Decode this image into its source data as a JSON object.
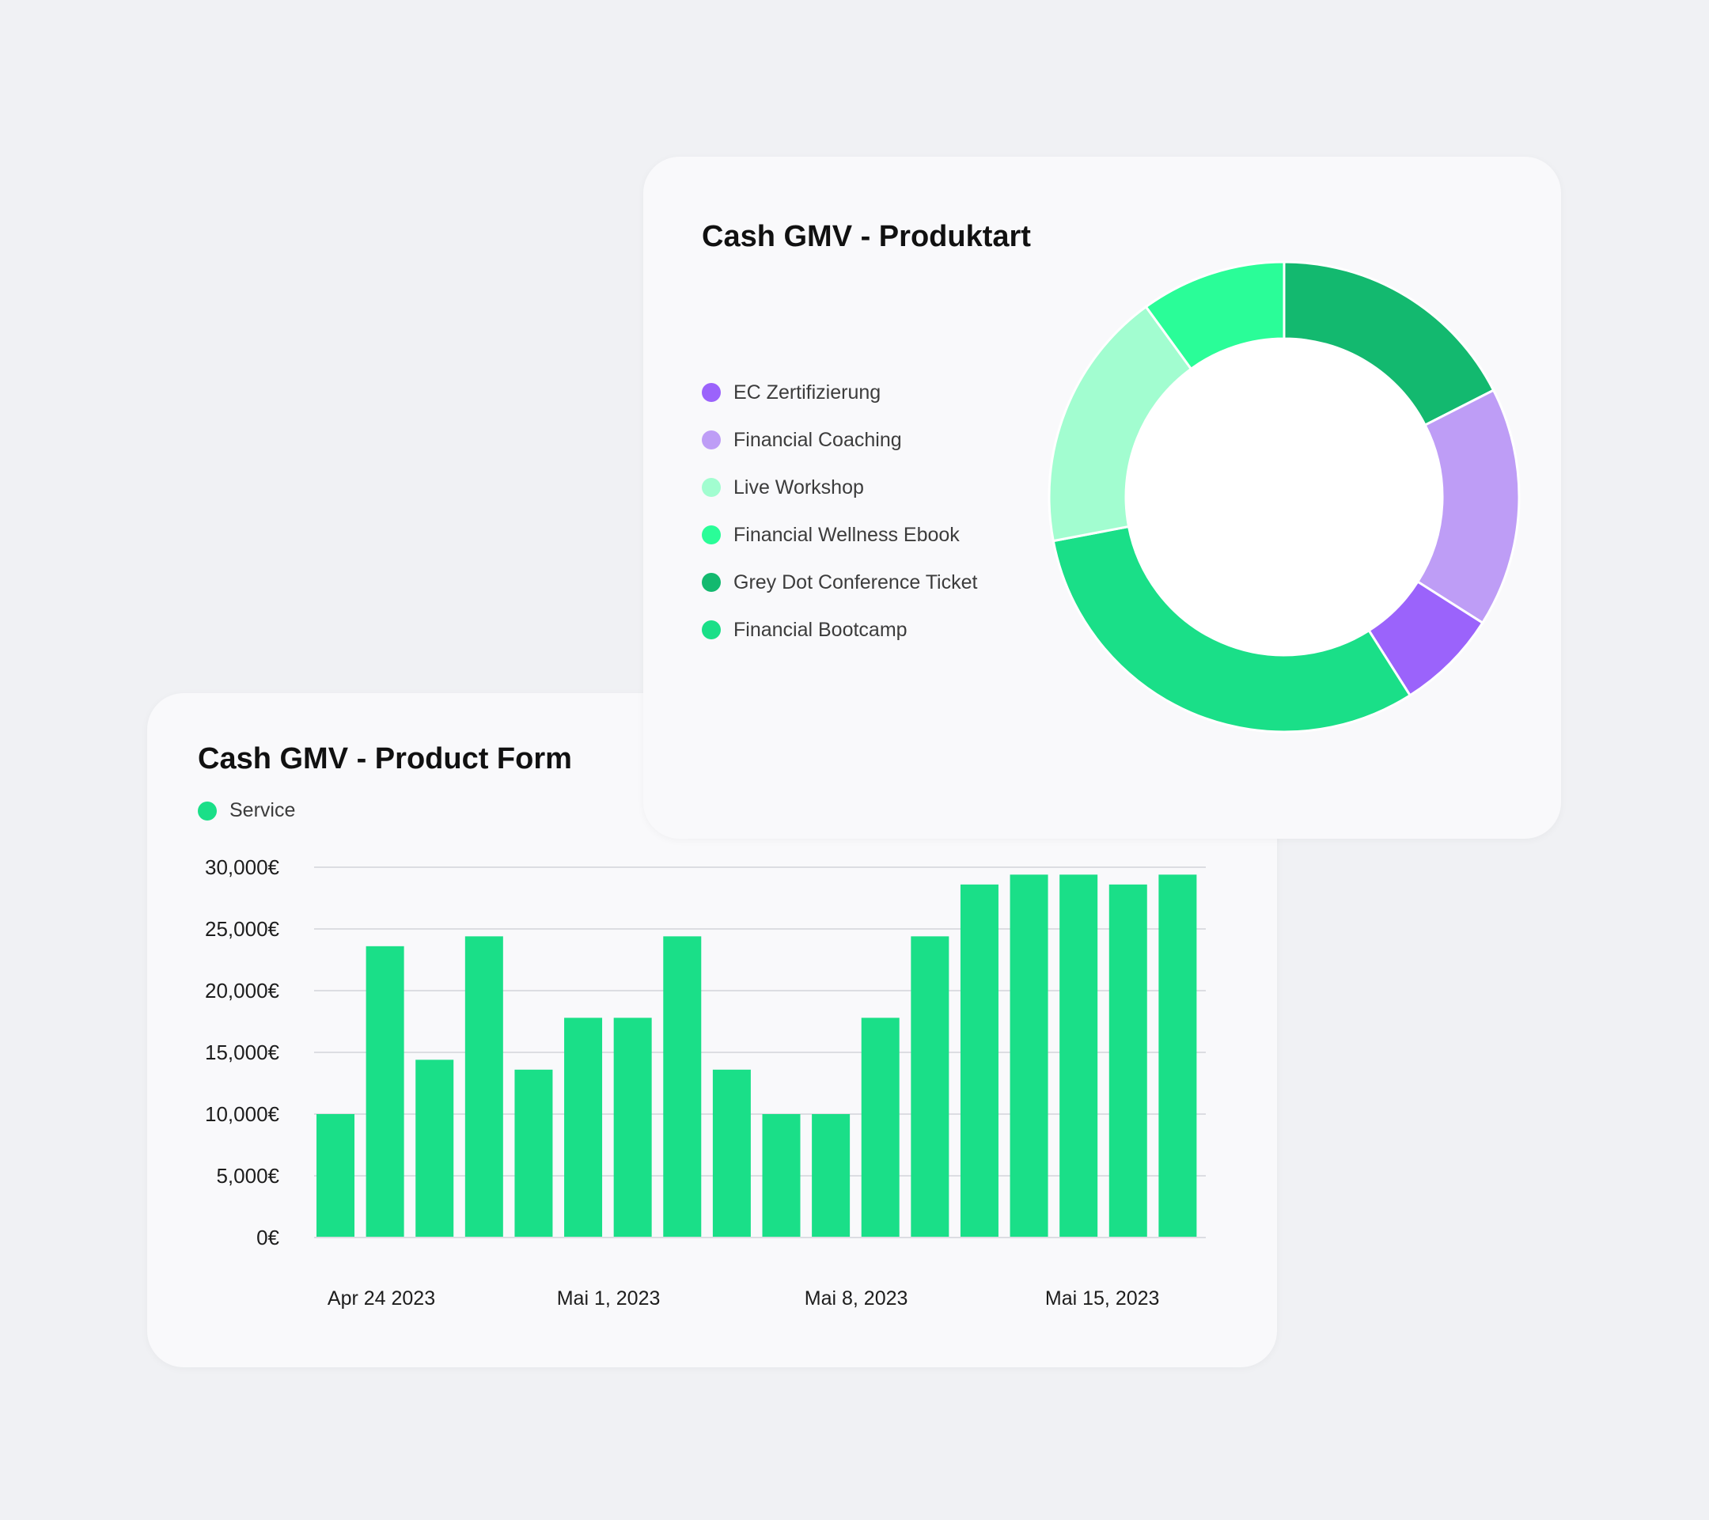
{
  "colors": {
    "background": "#f0f1f4",
    "card": "#f9f9fb",
    "bar": "#1adf88",
    "grid": "#dcdde2"
  },
  "chart_data": [
    {
      "type": "bar",
      "title": "Cash GMV - Product Form",
      "series": [
        {
          "name": "Service",
          "color": "#1adf88",
          "values": [
            10000,
            23600,
            14400,
            24400,
            13600,
            17800,
            17800,
            24400,
            13600,
            10000,
            10000,
            17800,
            24400,
            28600,
            29400,
            29400,
            28600,
            29400
          ]
        }
      ],
      "x_tick_labels": [
        "Apr 24 2023",
        "Mai 1, 2023",
        "Mai 8, 2023",
        "Mai 15, 2023"
      ],
      "y_tick_labels": [
        "0€",
        "5,000€",
        "10,000€",
        "15,000€",
        "20,000€",
        "25,000€",
        "30,000€"
      ],
      "ylim": [
        0,
        30000
      ],
      "grid": true,
      "legend_position": "top-left"
    },
    {
      "type": "pie",
      "subtype": "donut",
      "title": "Cash GMV - Produktart",
      "slices": [
        {
          "label": "EC Zertifizierung",
          "value": 7,
          "color": "#9b63fb"
        },
        {
          "label": "Financial Coaching",
          "value": 16.5,
          "color": "#be9df6"
        },
        {
          "label": "Live Workshop",
          "value": 18,
          "color": "#a2fdd0"
        },
        {
          "label": "Financial Wellness Ebook",
          "value": 10,
          "color": "#2afd98"
        },
        {
          "label": "Grey Dot Conference Ticket",
          "value": 17.5,
          "color": "#13b96f"
        },
        {
          "label": "Financial Bootcamp",
          "value": 31,
          "color": "#1adf88"
        }
      ],
      "render_order": [
        "Grey Dot Conference Ticket",
        "Financial Coaching",
        "EC Zertifizierung",
        "Financial Bootcamp",
        "Live Workshop",
        "Financial Wellness Ebook"
      ],
      "legend_position": "left"
    }
  ]
}
